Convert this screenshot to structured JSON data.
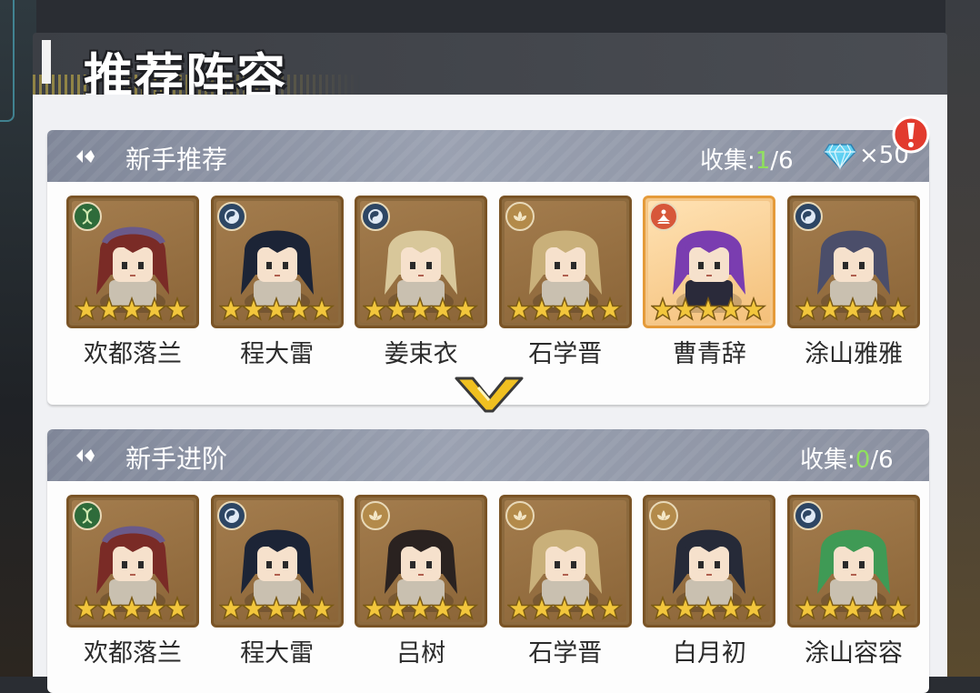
{
  "header": {
    "title": "推荐阵容"
  },
  "sections": [
    {
      "title": "新手推荐",
      "collect_label": "收集:",
      "collect_current": "1",
      "collect_total": "/6",
      "reward_count": "×50",
      "heroes": [
        {
          "name": "欢都落兰",
          "element": "dna",
          "stars": 5,
          "hair": "#7a2b26",
          "hat": "#6a5a8a",
          "bg": "normal"
        },
        {
          "name": "程大雷",
          "element": "swirl",
          "stars": 5,
          "hair": "#1c2436",
          "hat": null,
          "bg": "normal"
        },
        {
          "name": "姜束衣",
          "element": "swirl",
          "stars": 5,
          "hair": "#d8c79a",
          "hat": null,
          "bg": "normal"
        },
        {
          "name": "石学晋",
          "element": "lotus",
          "stars": 5,
          "hair": "#c9b07a",
          "hat": null,
          "bg": "normal"
        },
        {
          "name": "曹青辞",
          "element": "meditate",
          "stars": 5,
          "hair": "#7a3db0",
          "hat": null,
          "bg": "gold"
        },
        {
          "name": "涂山雅雅",
          "element": "swirl",
          "stars": 5,
          "hair": "#4b4e6a",
          "hat": null,
          "bg": "normal"
        }
      ]
    },
    {
      "title": "新手进阶",
      "collect_label": "收集:",
      "collect_current": "0",
      "collect_total": "/6",
      "heroes": [
        {
          "name": "欢都落兰",
          "element": "dna",
          "stars": 5,
          "hair": "#7a2b26",
          "hat": "#6a5a8a",
          "bg": "normal"
        },
        {
          "name": "程大雷",
          "element": "swirl",
          "stars": 5,
          "hair": "#1c2436",
          "hat": null,
          "bg": "normal"
        },
        {
          "name": "吕树",
          "element": "lotus",
          "stars": 5,
          "hair": "#2a2220",
          "hat": null,
          "bg": "normal"
        },
        {
          "name": "石学晋",
          "element": "lotus",
          "stars": 5,
          "hair": "#c9b07a",
          "hat": null,
          "bg": "normal"
        },
        {
          "name": "白月初",
          "element": "lotus",
          "stars": 5,
          "hair": "#262a38",
          "hat": null,
          "bg": "normal"
        },
        {
          "name": "涂山容容",
          "element": "swirl",
          "stars": 5,
          "hair": "#3f9a55",
          "hat": null,
          "bg": "normal"
        }
      ]
    }
  ],
  "icons": {
    "alert": "alert-icon",
    "gem": "diamond-gem-icon",
    "expand": "chevron-down-icon"
  },
  "colors": {
    "star": "#f2c63c",
    "highlight_green": "#8ee05a",
    "chevron": "#f0c020"
  }
}
